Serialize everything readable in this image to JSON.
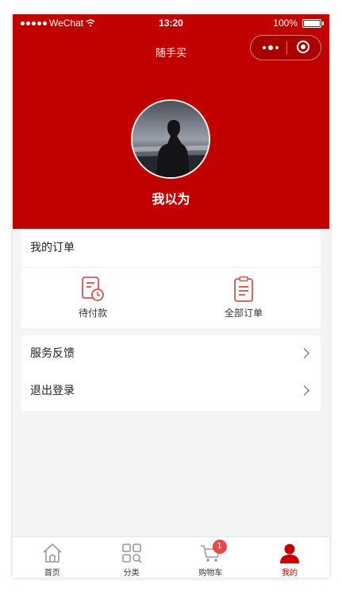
{
  "status_bar": {
    "carrier": "WeChat",
    "time": "13:20",
    "battery": "100%"
  },
  "nav": {
    "title": "随手买"
  },
  "profile": {
    "username": "我以为"
  },
  "orders": {
    "title": "我的订单",
    "items": [
      {
        "label": "待付款",
        "icon": "pending-payment-icon"
      },
      {
        "label": "全部订单",
        "icon": "all-orders-icon"
      }
    ]
  },
  "menu": {
    "items": [
      {
        "label": "服务反馈"
      },
      {
        "label": "退出登录"
      }
    ]
  },
  "tabbar": {
    "items": [
      {
        "label": "首页",
        "icon": "home-icon"
      },
      {
        "label": "分类",
        "icon": "category-icon"
      },
      {
        "label": "购物车",
        "icon": "cart-icon",
        "badge": "1"
      },
      {
        "label": "我的",
        "icon": "user-icon",
        "active": true
      }
    ]
  },
  "colors": {
    "brand_red": "#c10000",
    "badge_red": "#e84a4a",
    "background": "#f4f4f4"
  }
}
